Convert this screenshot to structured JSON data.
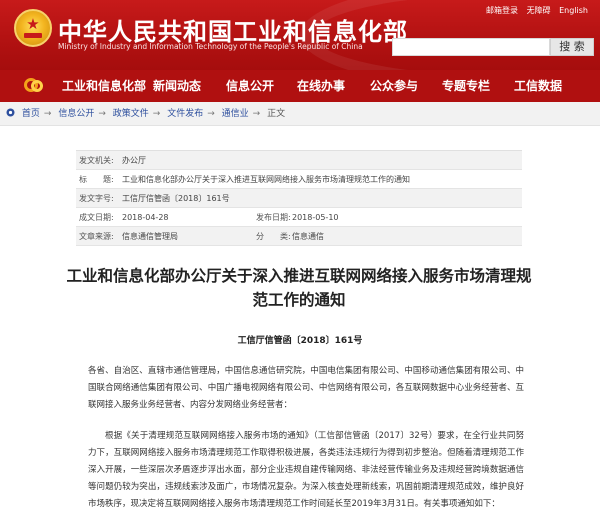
{
  "header": {
    "title_cn": "中华人民共和国工业和信息化部",
    "title_en": "Ministry of Industry and Information Technology of the People's Republic of China",
    "top_links": [
      "邮箱登录",
      "无障碍",
      "English"
    ],
    "search_placeholder": "",
    "search_button": "搜 索"
  },
  "nav": {
    "items": [
      "工业和信息化部",
      "新闻动态",
      "信息公开",
      "在线办事",
      "公众参与",
      "专题专栏",
      "工信数据"
    ]
  },
  "breadcrumb": {
    "items": [
      "首页",
      "信息公开",
      "政策文件",
      "文件发布",
      "通信业",
      "正文"
    ]
  },
  "meta": {
    "issuer_label": "发文机关:",
    "issuer": "办公厅",
    "title_label": "标　　题:",
    "title": "工业和信息化部办公厅关于深入推进互联网网络接入服务市场清理规范工作的通知",
    "docno_label": "发文字号:",
    "docno": "工信厅信管函〔2018〕161号",
    "created_label": "成文日期:",
    "created": "2018-04-28",
    "published_label": "发布日期:",
    "published": "2018-05-10",
    "source_label": "文章来源:",
    "source": "信息通信管理局",
    "category_label": "分　　类:",
    "category": "信息通信"
  },
  "article": {
    "title": "工业和信息化部办公厅关于深入推进互联网网络接入服务市场清理规范工作的通知",
    "doc_no": "工信厅信管函〔2018〕161号",
    "addressee": "各省、自治区、直辖市通信管理局，中国信息通信研究院，中国电信集团有限公司、中国移动通信集团有限公司、中国联合网络通信集团有限公司、中国广播电视网络有限公司、中信网络有限公司，各互联网数据中心业务经营者、互联网接入服务业务经营者、内容分发网络业务经营者：",
    "body": "根据《关于清理规范互联网网络接入服务市场的通知》（工信部信管函〔2017〕32号）要求，在全行业共同努力下，互联网网络接入服务市场清理规范工作取得积极进展，各类违法违规行为得到初步整治。但随着清理规范工作深入开展，一些深层次矛盾逐步浮出水面，部分企业违规自建传输网络、非法经营传输业务及违规经营跨境数据通信等问题仍较为突出，违规线索涉及面广，市场情况复杂。为深入核查处理新线索，巩固前期清理规范成效，维护良好市场秩序，现决定将互联网网络接入服务市场清理规范工作时间延长至2019年3月31日。有关事项通知如下："
  }
}
